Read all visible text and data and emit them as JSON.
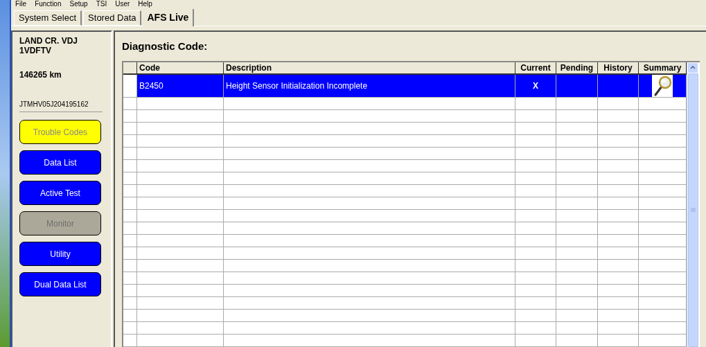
{
  "menu": [
    "File",
    "Function",
    "Setup",
    "TSI",
    "User",
    "Help"
  ],
  "tabs": [
    {
      "label": "System Select",
      "selected": false
    },
    {
      "label": "Stored Data",
      "selected": false
    },
    {
      "label": "AFS Live",
      "selected": true
    }
  ],
  "vehicle": {
    "model": "LAND CR. VDJ",
    "engine": "1VDFTV",
    "odometer": "146265 km",
    "vin": "JTMHV05J204195162"
  },
  "nav_buttons": [
    {
      "label": "Trouble Codes",
      "selected": true,
      "disabled": false
    },
    {
      "label": "Data List",
      "selected": false,
      "disabled": false
    },
    {
      "label": "Active Test",
      "selected": false,
      "disabled": false
    },
    {
      "label": "Monitor",
      "selected": false,
      "disabled": true
    },
    {
      "label": "Utility",
      "selected": false,
      "disabled": false
    },
    {
      "label": "Dual Data List",
      "selected": false,
      "disabled": false
    }
  ],
  "title": "Diagnostic Code:",
  "table": {
    "columns": [
      "Code",
      "Description",
      "Current",
      "Pending",
      "History",
      "Summary"
    ],
    "rows": [
      {
        "selected": true,
        "code": "B2450",
        "description": "Height Sensor Initialization Incomplete",
        "current": "X",
        "summary_icon": true
      }
    ]
  }
}
